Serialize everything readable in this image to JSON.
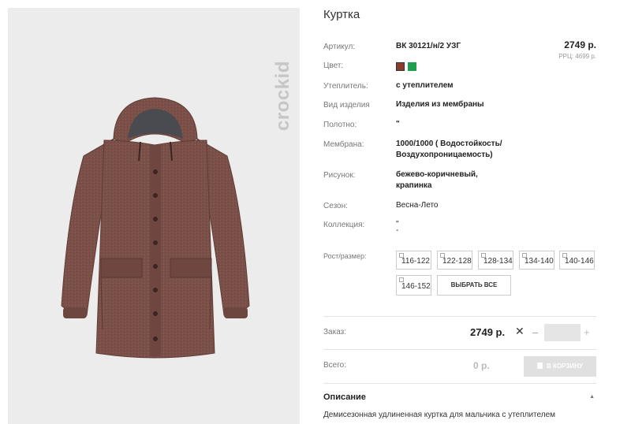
{
  "brand": {
    "name": "crockid"
  },
  "product": {
    "title": "Куртка",
    "price": "2749 р.",
    "rrp": "РРЦ: 4699 р.",
    "rows": [
      {
        "label": "Артикул:",
        "value": "ВК 30121/н/2 УЗГ"
      },
      {
        "label": "Цвет:",
        "value": ""
      },
      {
        "label": "Утеплитель:",
        "value": "с утеплителем"
      },
      {
        "label": "Вид изделия",
        "value": "Изделия из мембраны"
      },
      {
        "label": "Полотно:",
        "value": "\""
      },
      {
        "label": "Мембрана:",
        "value_lines": [
          "1000/1000 ( Водостойкость/",
          "Воздухопроницаемость)"
        ]
      },
      {
        "label": "Рисунок:",
        "value_lines": [
          "бежево-коричневый,",
          "крапинка"
        ]
      },
      {
        "label": "Сезон:",
        "value": "Весна-Лето"
      },
      {
        "label": "Коллекция:",
        "value_lines": [
          "\"",
          "-"
        ]
      },
      {
        "label": "Рост/размер:"
      }
    ],
    "colors": [
      "#8a3d2e",
      "#1f9e4f"
    ],
    "sizes": [
      "116-122",
      "122-128",
      "128-134",
      "134-140",
      "140-146",
      "146-152"
    ],
    "select_all": "ВЫБРАТЬ ВСЕ"
  },
  "order": {
    "label": "Заказ:",
    "price": "2749 р.",
    "multiply": "✕",
    "minus": "–",
    "plus": "+",
    "quantity": ""
  },
  "total": {
    "label": "Всего:",
    "value": "0 р.",
    "cart_button": "В КОРЗИНУ"
  },
  "description": {
    "title": "Описание",
    "toggle": "▲",
    "text": "Демисезонная удлиненная куртка для мальчика с утеплителем"
  }
}
